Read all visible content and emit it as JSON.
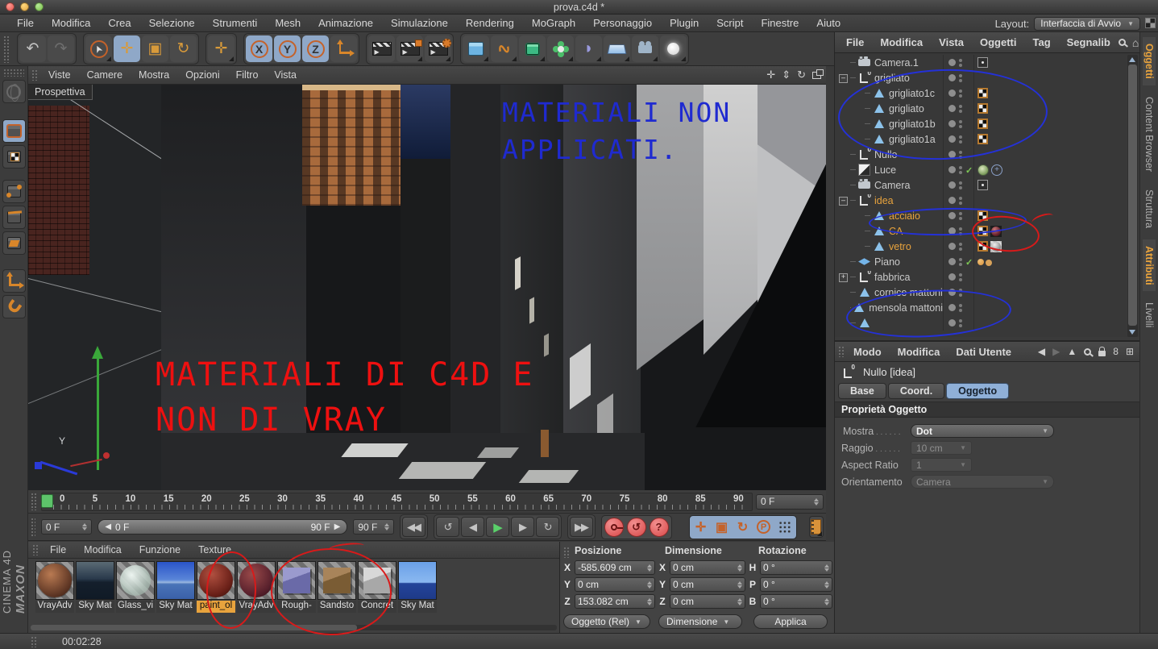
{
  "window": {
    "title": "prova.c4d *"
  },
  "menubar": {
    "items": [
      "File",
      "Modifica",
      "Crea",
      "Selezione",
      "Strumenti",
      "Mesh",
      "Animazione",
      "Simulazione",
      "Rendering",
      "MoGraph",
      "Personaggio",
      "Plugin",
      "Script",
      "Finestre",
      "Aiuto"
    ],
    "layout_label": "Layout:",
    "layout_value": "Interfaccia di Avvio"
  },
  "viewport": {
    "menu": [
      "Viste",
      "Camere",
      "Mostra",
      "Opzioni",
      "Filtro",
      "Vista"
    ],
    "view_label": "Prospettiva",
    "axis_label": "Y",
    "annotation_blue": {
      "line1": "MATERIALI NON",
      "line2": "APPLICATI."
    },
    "annotation_red": {
      "line1": "MATERIALI DI C4D E",
      "line2": "NON DI VRAY"
    }
  },
  "timeline": {
    "ticks": [
      "0",
      "5",
      "10",
      "15",
      "20",
      "25",
      "30",
      "35",
      "40",
      "45",
      "50",
      "55",
      "60",
      "65",
      "70",
      "75",
      "80",
      "85",
      "90"
    ],
    "frame_field": "0 F",
    "current_frame": "0 F",
    "range_start": "0 F",
    "range_end": "90 F",
    "end_frame": "90 F"
  },
  "object_manager": {
    "menu": [
      "File",
      "Modifica",
      "Vista",
      "Oggetti",
      "Tag",
      "Segnalib"
    ],
    "objects": [
      {
        "name": "Camera.1",
        "icon": "i-cam",
        "depth": "d0",
        "tag1": "t-camtag"
      },
      {
        "name": "grigliato",
        "icon": "i-null",
        "depth": "d0",
        "exp": "minus"
      },
      {
        "name": "grigliato1c",
        "icon": "i-poly",
        "depth": "d1",
        "tag1": "t-checker"
      },
      {
        "name": "grigliato",
        "icon": "i-poly",
        "depth": "d1",
        "tag1": "t-checker"
      },
      {
        "name": "grigliato1b",
        "icon": "i-poly",
        "depth": "d1",
        "tag1": "t-checker"
      },
      {
        "name": "grigliato1a",
        "icon": "i-poly",
        "depth": "d1",
        "tag1": "t-checker"
      },
      {
        "name": "Nullo",
        "icon": "i-null",
        "depth": "d0"
      },
      {
        "name": "Luce",
        "icon": "i-light",
        "depth": "d0",
        "vis": "check",
        "tag1": "t-vray",
        "tag2": "t-target"
      },
      {
        "name": "Camera",
        "icon": "i-cam",
        "depth": "d0",
        "tag1": "t-camtag"
      },
      {
        "name": "idea",
        "icon": "i-null",
        "depth": "d0",
        "sel": "sel",
        "exp": "minus"
      },
      {
        "name": "acciaio",
        "icon": "i-poly",
        "depth": "d1",
        "sel": "sel",
        "tag1": "t-checker"
      },
      {
        "name": "CA",
        "icon": "i-poly",
        "depth": "d1",
        "sel": "sel",
        "tag1": "t-checker",
        "tag2": "t-sphred"
      },
      {
        "name": "vetro",
        "icon": "i-poly",
        "depth": "d1",
        "sel": "sel",
        "tag1": "t-checker",
        "tag2": "t-sphgray"
      },
      {
        "name": "Piano",
        "icon": "i-plane",
        "depth": "d0",
        "vis": "check",
        "tag1": "t-dots"
      },
      {
        "name": "fabbrica",
        "icon": "i-null",
        "depth": "d0",
        "exp": "plus"
      },
      {
        "name": "cornice mattoni",
        "icon": "i-poly",
        "depth": "d0"
      },
      {
        "name": "mensola mattoni",
        "icon": "i-poly",
        "depth": "d0"
      },
      {
        "name": "",
        "icon": "i-poly",
        "depth": "d0"
      }
    ]
  },
  "side_tabs": {
    "objects": "Oggetti",
    "content_browser": "Content Browser",
    "structure": "Struttura",
    "attributes": "Attributi",
    "layers": "Livelli"
  },
  "attributes": {
    "menu": [
      "Modo",
      "Modifica",
      "Dati Utente"
    ],
    "object_title": "Nullo [idea]",
    "tabs": [
      {
        "label": "Base",
        "cls": ""
      },
      {
        "label": "Coord.",
        "cls": ""
      },
      {
        "label": "Oggetto",
        "cls": "active"
      }
    ],
    "section_title": "Proprietà Oggetto",
    "fields": [
      {
        "label": "Mostra",
        "value": "Dot",
        "cls": "k-drop on",
        "row": "leader on-label"
      },
      {
        "label": "Raggio",
        "value": "10 cm",
        "cls": "k-spin off",
        "row": "leader"
      },
      {
        "label": "Aspect Ratio",
        "value": "1",
        "cls": "k-spin off",
        "row": ""
      },
      {
        "label": "Orientamento",
        "value": "Camera",
        "cls": "k-drop off",
        "row": ""
      }
    ]
  },
  "materials": {
    "menu": [
      "File",
      "Modifica",
      "Funzione",
      "Texture"
    ],
    "items": [
      {
        "label": "VrayAdv",
        "thumb": "m-vray1",
        "sel": ""
      },
      {
        "label": "Sky Mat",
        "thumb": "m-skydark",
        "sel": ""
      },
      {
        "label": "Glass_vi",
        "thumb": "m-glass",
        "sel": ""
      },
      {
        "label": "Sky Mat",
        "thumb": "m-skyblue",
        "sel": ""
      },
      {
        "label": "paint_ol",
        "thumb": "m-paint",
        "sel": "sel"
      },
      {
        "label": "VrayAdv",
        "thumb": "m-vray2",
        "sel": ""
      },
      {
        "label": "Rough-",
        "thumb": "m-cubepurple",
        "sel": ""
      },
      {
        "label": "Sandsto",
        "thumb": "m-cubebrown",
        "sel": ""
      },
      {
        "label": "Concret",
        "thumb": "m-cubegray",
        "sel": ""
      },
      {
        "label": "Sky Mat",
        "thumb": "m-skysea",
        "sel": ""
      }
    ]
  },
  "coords": {
    "headers": [
      "Posizione",
      "Dimensione",
      "Rotazione"
    ],
    "position": {
      "x_label": "X",
      "x": "-585.609 cm",
      "y_label": "Y",
      "y": "0 cm",
      "z_label": "Z",
      "z": "153.082 cm"
    },
    "size": {
      "x_label": "X",
      "x": "0 cm",
      "y_label": "Y",
      "y": "0 cm",
      "z_label": "Z",
      "z": "0 cm"
    },
    "rotation": {
      "h_label": "H",
      "h": "0 °",
      "p_label": "P",
      "p": "0 °",
      "b_label": "B",
      "b": "0 °"
    },
    "mode_object": "Oggetto (Rel)",
    "mode_size": "Dimensione",
    "apply_label": "Applica"
  },
  "statusbar": {
    "time": "00:02:28"
  },
  "branding": {
    "maxon": "MAXON",
    "cinema": "CINEMA 4D"
  },
  "icons": {
    "undo": "↶",
    "redo": "↷",
    "cursor": "➤",
    "move": "✛",
    "scale": "▣",
    "rotate": "↻",
    "axis_x": "X",
    "axis_y": "Y",
    "axis_z": "Z",
    "spline": "∿",
    "deformer": "◗",
    "vp_move": "✛",
    "vp_zoom": "⇕",
    "vp_rotate": "↻",
    "home": "⌂",
    "add_box": "⊞",
    "nav_back": "◀",
    "nav_fwd": "▶",
    "nav_up": "▲",
    "history": "8",
    "goto_start": "◀◀",
    "prev_key": "↺",
    "prev_frame": "◀",
    "play": "▶",
    "next_frame": "▶",
    "next_key": "↻",
    "goto_end": "▶▶",
    "autokey": "↺",
    "help": "?",
    "p_tool": "P"
  },
  "colors": {
    "accent_orange": "#e8a33d",
    "selection_blue": "#8fa8c8",
    "pen_red": "#d81a1a",
    "pen_blue": "#2431d8",
    "play_green": "#5dc36a"
  }
}
